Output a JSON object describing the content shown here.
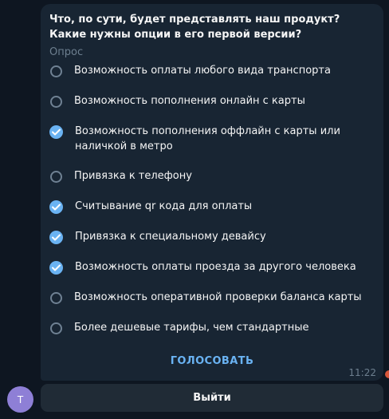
{
  "poll": {
    "question": "Что, по сути, будет представлять наш продукт? Какие нужны опции в его первой версии?",
    "type_label": "Опрос",
    "options": [
      {
        "label": "Возможность оплаты любого вида транспорта",
        "selected": false
      },
      {
        "label": "Возможность пополнения онлайн с карты",
        "selected": false
      },
      {
        "label": "Возможность пополнения оффлайн с карты или наличкой в метро",
        "selected": true
      },
      {
        "label": "Привязка к телефону",
        "selected": false
      },
      {
        "label": "Считывание qr кода для оплаты",
        "selected": true
      },
      {
        "label": "Привязка к специальному девайсу",
        "selected": true
      },
      {
        "label": "Возможность оплаты проезда за другого человека",
        "selected": true
      },
      {
        "label": "Возможность оперативной проверки баланса карты",
        "selected": false
      },
      {
        "label": "Более дешевые тарифы, чем стандартные",
        "selected": false
      }
    ],
    "vote_label": "ГОЛОСОВАТЬ",
    "time": "11:22"
  },
  "sender": {
    "avatar_letter": "T"
  },
  "keyboard": {
    "exit_label": "Выйти"
  },
  "colors": {
    "background": "#0e1621",
    "bubble": "#182533",
    "accent": "#6ab3f3",
    "muted": "#6d7f8f",
    "avatar": "#8e7fd6"
  }
}
